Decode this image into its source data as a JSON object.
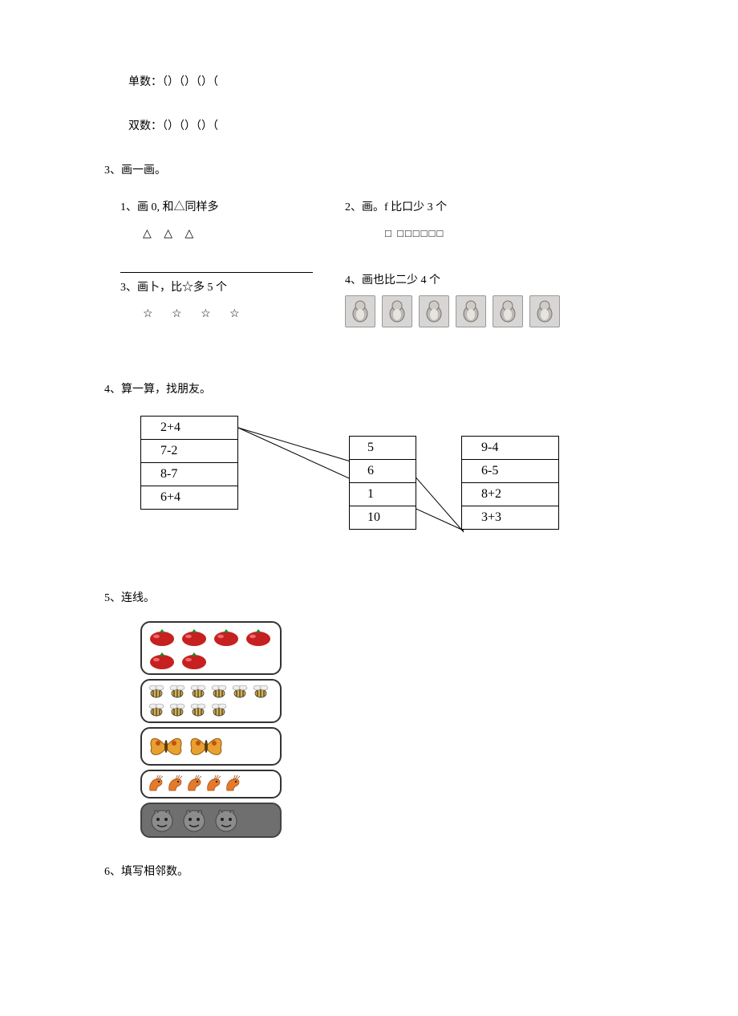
{
  "top": {
    "odd": "单数：（）（）（）（",
    "even": "双数：（）（）（）（"
  },
  "q3": {
    "head": "3、画一画。",
    "s1": {
      "label": "1、画 0, 和△同样多",
      "shapes": "△  △  △"
    },
    "s2": {
      "label": "2、画。f 比口少 3 个",
      "shapes": "□  □□□□□□"
    },
    "s3": {
      "label": "3、画卜，比☆多 5 个",
      "shapes": "☆  ☆  ☆  ☆"
    },
    "s4": {
      "label": "4、画也比二少 4 个",
      "count": 6
    }
  },
  "q4": {
    "head": "4、算一算，找朋友。",
    "col1": [
      "2+4",
      "7-2",
      "8-7",
      "6+4"
    ],
    "col2": [
      "5",
      "6",
      "1",
      "10"
    ],
    "col3": [
      "9-4",
      "6-5",
      "8+2",
      "3+3"
    ]
  },
  "q5": {
    "head": "5、连线。",
    "rows": [
      {
        "type": "tomato",
        "count": 6
      },
      {
        "type": "bee",
        "count": 10
      },
      {
        "type": "butterfly",
        "count": 2
      },
      {
        "type": "shrimp",
        "count": 5
      },
      {
        "type": "face",
        "count": 3
      }
    ]
  },
  "q6": {
    "head": "6、填写相邻数。"
  }
}
